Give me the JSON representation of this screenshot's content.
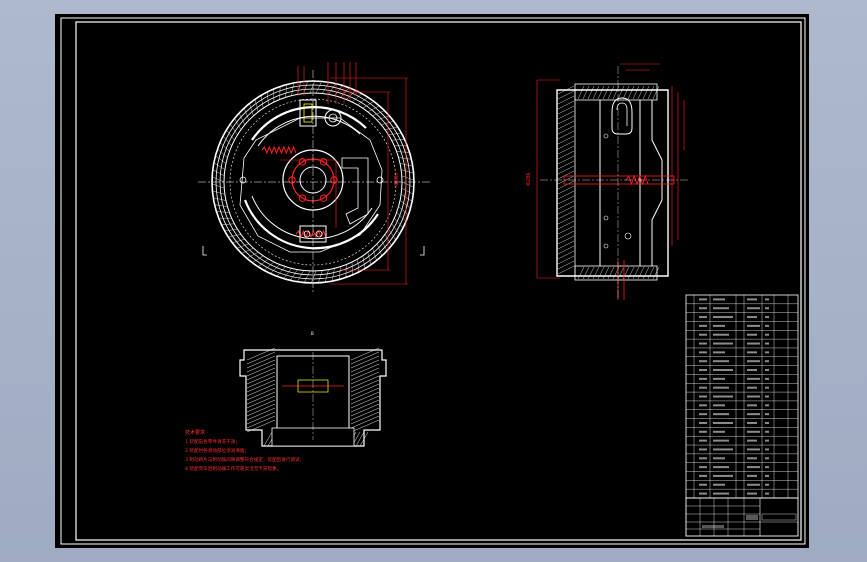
{
  "drawing": {
    "background_color": "#000000",
    "frame_color": "#ffffff",
    "geometry_color": "#ffffff",
    "dimension_color": "#ff2020",
    "accent_color": "#ffff00",
    "notes_color": "#ff3030",
    "section_marker_top": "A",
    "section_marker_left": "A",
    "detail_marker": "B",
    "dimension_diameter": "Φ380",
    "dimension_inner": "Φ286",
    "title_block_drawing_no": "",
    "title_block_scale": ""
  },
  "notes": {
    "heading": "技术要求",
    "items": [
      "1.装配前各零件清洗干净；",
      "2.装配时各滑动部位涂润滑脂；",
      "3.制动蹄片与制动鼓间隙调整符合规定，装配后进行调试；",
      "4.装配完毕后制动器工作可靠灵活无卡滞现象。"
    ]
  },
  "parts_list": {
    "row_count": 23
  }
}
